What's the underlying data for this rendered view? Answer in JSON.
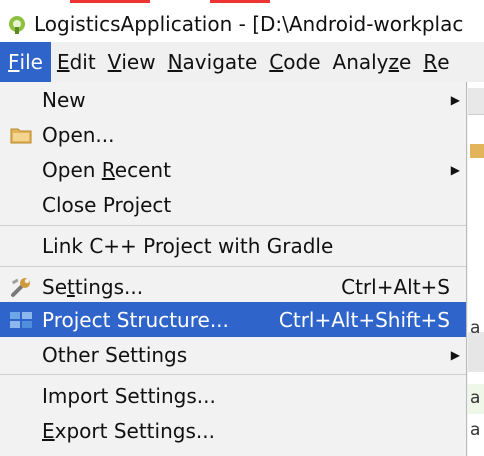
{
  "window": {
    "title": "LogisticsApplication - [D:\\Android-workplac"
  },
  "menubar": {
    "items": [
      {
        "pre": "",
        "u": "F",
        "post": "ile"
      },
      {
        "pre": "",
        "u": "E",
        "post": "dit"
      },
      {
        "pre": "",
        "u": "V",
        "post": "iew"
      },
      {
        "pre": "",
        "u": "N",
        "post": "avigate"
      },
      {
        "pre": "",
        "u": "C",
        "post": "ode"
      },
      {
        "pre": "Analy",
        "u": "z",
        "post": "e"
      },
      {
        "pre": "",
        "u": "R",
        "post": "e"
      }
    ]
  },
  "file_menu": {
    "new": "New",
    "open": "Open...",
    "open_recent_pre": "Open ",
    "open_recent_u": "R",
    "open_recent_post": "ecent",
    "close_project": "Close Project",
    "link_cpp": "Link C++ Project with Gradle",
    "settings_pre": "Se",
    "settings_u": "t",
    "settings_post": "tings...",
    "settings_shortcut": "Ctrl+Alt+S",
    "project_structure": "Project Structure...",
    "project_structure_shortcut": "Ctrl+Alt+Shift+S",
    "other_settings": "Other Settings",
    "import_settings": "Import Settings...",
    "export_settings_u": "E",
    "export_settings_post": "xport Settings..."
  },
  "background": {
    "letter": "a"
  },
  "colors": {
    "highlight": "#2f65ca",
    "folder": "#e3b55a",
    "android": "#8fbf3f"
  }
}
